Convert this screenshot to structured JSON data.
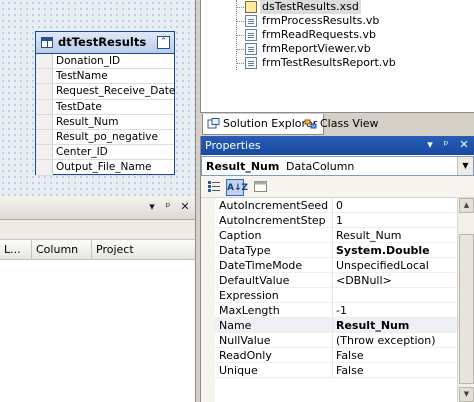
{
  "designer": {
    "table_name": "dtTestResults",
    "columns": [
      "Donation_ID",
      "TestName",
      "Request_Receive_Date",
      "TestDate",
      "Result_Num",
      "Result_po_negative",
      "Center_ID",
      "Output_File_Name"
    ]
  },
  "solution_explorer": {
    "files": [
      "dsTestResults.xsd",
      "frmProcessResults.vb",
      "frmReadRequests.vb",
      "frmReportViewer.vb",
      "frmTestResultsReport.vb"
    ]
  },
  "bottom_tabs": {
    "solution_explorer": "Solution Explorer",
    "class_view": "Class View"
  },
  "error_list": {
    "columns": [
      "L...",
      "Column",
      "Project"
    ]
  },
  "properties": {
    "title": "Properties",
    "object_name": "Result_Num",
    "object_type": "DataColumn",
    "rows": [
      {
        "name": "AutoIncrementSeed",
        "value": "0"
      },
      {
        "name": "AutoIncrementStep",
        "value": "1"
      },
      {
        "name": "Caption",
        "value": "Result_Num"
      },
      {
        "name": "DataType",
        "value": "System.Double"
      },
      {
        "name": "DateTimeMode",
        "value": "UnspecifiedLocal"
      },
      {
        "name": "DefaultValue",
        "value": "<DBNull>"
      },
      {
        "name": "Expression",
        "value": ""
      },
      {
        "name": "MaxLength",
        "value": "-1"
      },
      {
        "name": "Name",
        "value": "Result_Num"
      },
      {
        "name": "NullValue",
        "value": "(Throw exception)"
      },
      {
        "name": "ReadOnly",
        "value": "False"
      },
      {
        "name": "Unique",
        "value": "False"
      }
    ]
  },
  "icons": {
    "pin": "pin-icon",
    "close": "close-icon",
    "dropdown": "dropdown-arrow-icon"
  }
}
